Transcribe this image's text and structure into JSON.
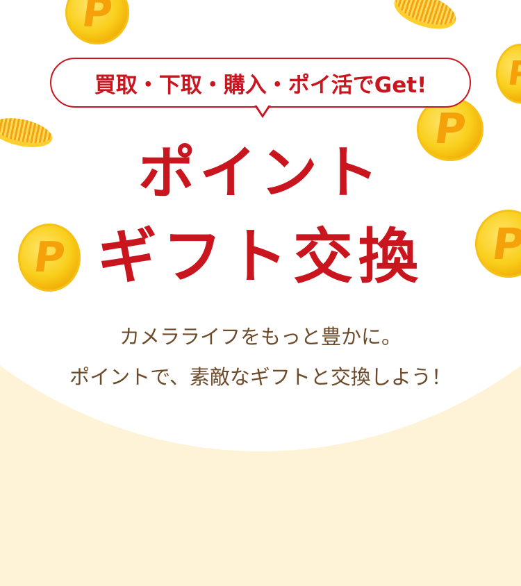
{
  "bubble": {
    "text": "買取・下取・購入・ポイ活でGet!"
  },
  "title": {
    "line1": "ポイント",
    "line2": "ギフト交換"
  },
  "subtitle": {
    "line1": "カメラライフをもっと豊かに。",
    "line2": "ポイントで、素敵なギフトと交換しよう！"
  },
  "coin_letter": "P",
  "colors": {
    "accent": "#c9151e",
    "text_brown": "#6d4b2a",
    "background": "#fef3d6",
    "coin": "#f9cf1c"
  }
}
